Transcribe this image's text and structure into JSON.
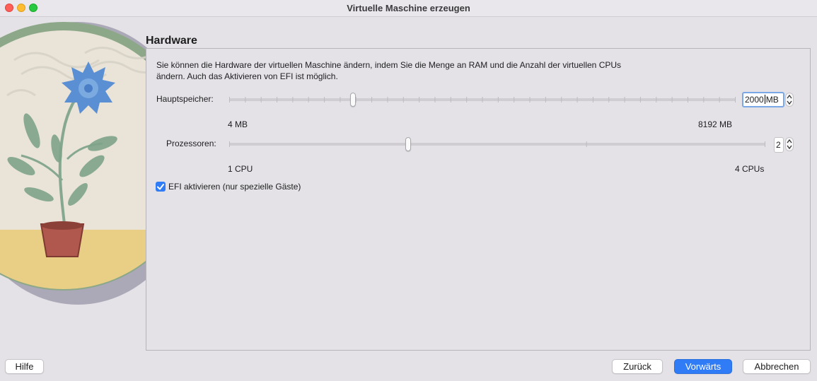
{
  "window": {
    "title": "Virtuelle Maschine erzeugen"
  },
  "section": {
    "title": "Hardware"
  },
  "description": {
    "line1": "Sie können die Hardware der virtuellen Maschine ändern, indem Sie die Menge an RAM und die Anzahl der virtuellen CPUs",
    "line2": "ändern. Auch das Aktivieren von EFI ist möglich."
  },
  "memory": {
    "label": "Hauptspeicher:",
    "value": "2000",
    "unit": "MB",
    "min_label": "4 MB",
    "max_label": "8192 MB",
    "min": 4,
    "max": 8192,
    "current": 2000
  },
  "processors": {
    "label": "Prozessoren:",
    "value": "2",
    "min_label": "1 CPU",
    "max_label": "4 CPUs",
    "min": 1,
    "max": 4,
    "current": 2
  },
  "efi": {
    "label": "EFI aktivieren (nur spezielle Gäste)",
    "checked": true
  },
  "buttons": {
    "help": "Hilfe",
    "back": "Zurück",
    "next": "Vorwärts",
    "cancel": "Abbrechen"
  },
  "colors": {
    "accent": "#2f7cf6",
    "window_bg": "#e4e2e6"
  },
  "icons": {
    "illustration": "plant-in-pot-illustration",
    "checkbox": "checkmark-icon",
    "stepper": "up-down-stepper-icon"
  }
}
